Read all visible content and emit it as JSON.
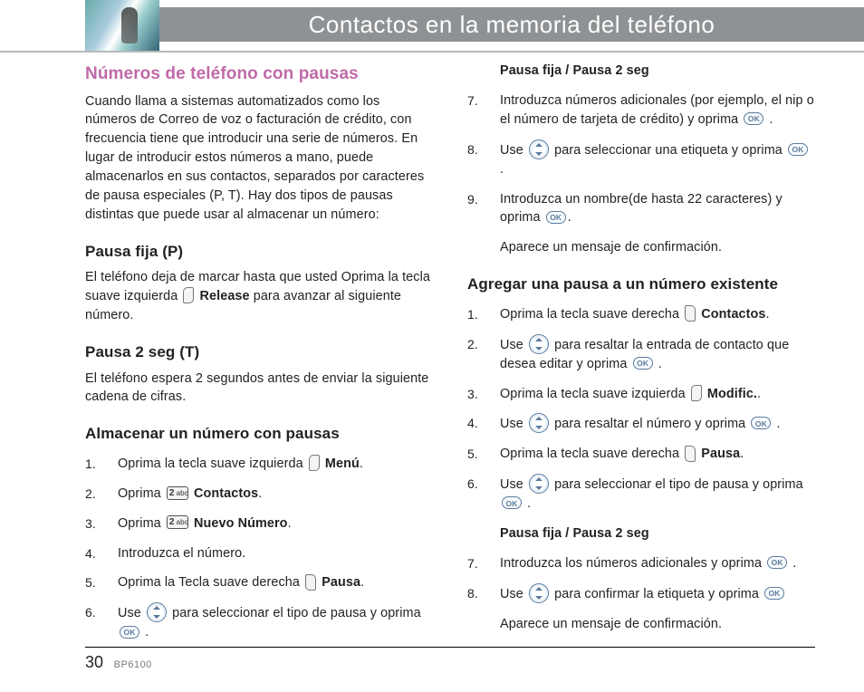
{
  "header": {
    "title": "Contactos en la memoria del teléfono"
  },
  "footer": {
    "page": "30",
    "model": "BP6100"
  },
  "left": {
    "h2": "Números de teléfono con pausas",
    "intro": "Cuando llama a sistemas automatizados como los números de Correo de voz o facturación de crédito, con frecuencia tiene que introducir una serie de números. En lugar de introducir estos números a mano, puede almacenarlos en sus contactos, separados por caracteres de pausa especiales (P, T). Hay dos tipos de pausas distintas que puede usar al almacenar un número:",
    "pausa_p_h": "Pausa fija (P)",
    "pausa_p_t1": "El teléfono deja de marcar hasta que usted Oprima la tecla suave izquierda ",
    "pausa_p_bold": "Release",
    "pausa_p_t2": " para avanzar al siguiente número.",
    "pausa_t_h": "Pausa 2 seg (T)",
    "pausa_t_p": "El teléfono espera 2 segundos antes de enviar la siguiente cadena de cifras.",
    "almacenar_h": "Almacenar un número con pausas",
    "s1_a": "Oprima la tecla suave izquierda ",
    "s1_b": "Menú",
    "s2_a": "Oprima ",
    "s2_b": "Contactos",
    "s3_a": "Oprima ",
    "s3_b": "Nuevo Número",
    "s4": "Introduzca el número.",
    "s5_a": "Oprima la Tecla suave derecha ",
    "s5_b": "Pausa",
    "s6_a": "Use ",
    "s6_b": " para seleccionar el tipo de pausa y oprima "
  },
  "right": {
    "pline": "Pausa fija / Pausa 2 seg",
    "s7_a": "Introduzca números adicionales (por ejemplo, el nip o el número de tarjeta de crédito) y oprima ",
    "s8_a": "Use ",
    "s8_b": " para seleccionar una etiqueta y oprima ",
    "s9_a": "Introduzca un nombre(de hasta 22 caracteres) y oprima ",
    "confirm": "Aparece un mensaje de confirmación.",
    "agregar_h": "Agregar una pausa a un número existente",
    "a1_a": "Oprima la tecla suave derecha ",
    "a1_b": "Contactos",
    "a2_a": "Use ",
    "a2_b": " para resaltar la entrada de contacto que desea editar y oprima ",
    "a3_a": "Oprima la tecla suave izquierda ",
    "a3_b": "Modific.",
    "a4_a": "Use ",
    "a4_b": " para resaltar el número y oprima ",
    "a5_a": "Oprima la tecla suave derecha ",
    "a5_b": "Pausa",
    "a6_a": "Use ",
    "a6_b": " para seleccionar el tipo de pausa y oprima ",
    "pline2": "Pausa fija / Pausa 2 seg",
    "a7_a": "Introduzca los números adicionales y oprima ",
    "a8_a": "Use ",
    "a8_b": " para confirmar la etiqueta y oprima ",
    "confirm2": "Aparece un mensaje de confirmación."
  }
}
